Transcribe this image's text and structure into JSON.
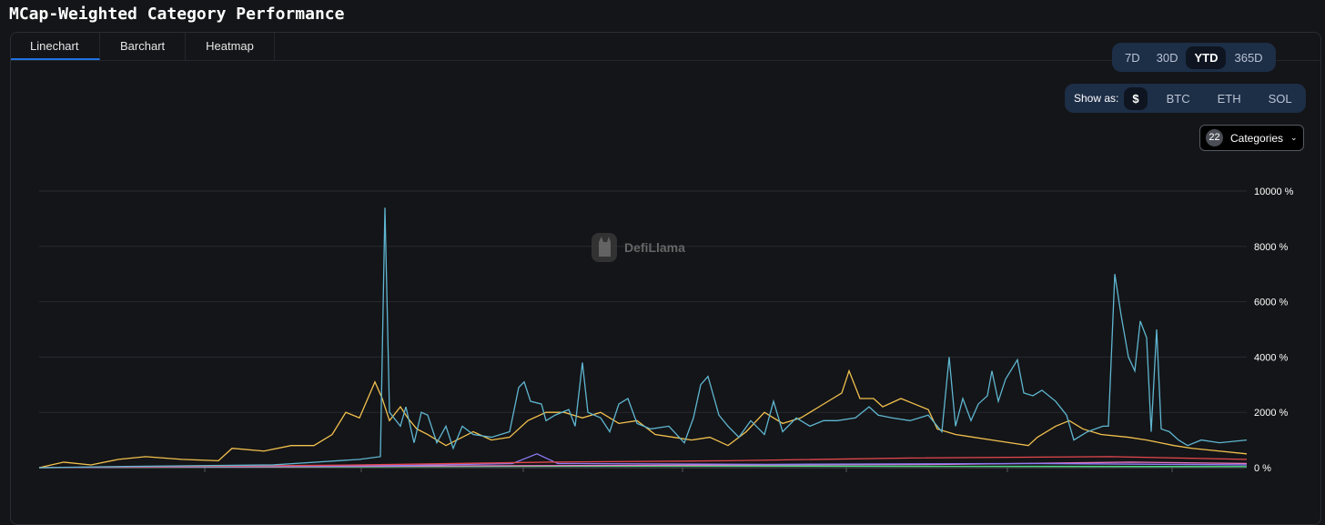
{
  "title": "MCap-Weighted Category Performance",
  "tabs": [
    "Linechart",
    "Barchart",
    "Heatmap"
  ],
  "ranges": [
    "7D",
    "30D",
    "YTD",
    "365D"
  ],
  "selected_range": "YTD",
  "show_as": {
    "label": "Show as:",
    "options": [
      "$",
      "BTC",
      "ETH",
      "SOL"
    ],
    "selected": "$"
  },
  "categories": {
    "count": "22",
    "label": "Categories"
  },
  "watermark": "DefiLlama",
  "colors": {
    "accent": "#2172e5"
  },
  "chart_data": {
    "type": "line",
    "title": "",
    "xlabel": "",
    "ylabel": "",
    "ylim": [
      0,
      10000
    ],
    "xlim": [
      0,
      132.7
    ],
    "grid": true,
    "yticks": [
      "0 %",
      "2000 %",
      "4000 %",
      "6000 %",
      "8000 %",
      "10000 %"
    ],
    "series": [
      {
        "name": "series-blue",
        "color": "#5fb6d1",
        "points": [
          [
            0,
            0
          ],
          [
            10.7,
            50
          ],
          [
            25.7,
            100
          ],
          [
            35.2,
            300
          ],
          [
            37.5,
            400
          ],
          [
            38,
            9400
          ],
          [
            38.5,
            2000
          ],
          [
            39.7,
            1500
          ],
          [
            40.3,
            2200
          ],
          [
            41.2,
            900
          ],
          [
            42,
            2000
          ],
          [
            42.7,
            1900
          ],
          [
            43.7,
            900
          ],
          [
            44.7,
            1500
          ],
          [
            45.5,
            700
          ],
          [
            46.5,
            1500
          ],
          [
            47.7,
            1200
          ],
          [
            49.7,
            1100
          ],
          [
            51.7,
            1300
          ],
          [
            52.7,
            2900
          ],
          [
            53.3,
            3100
          ],
          [
            54,
            2400
          ],
          [
            55.2,
            2300
          ],
          [
            55.7,
            1700
          ],
          [
            56.7,
            1900
          ],
          [
            58.2,
            2100
          ],
          [
            58.9,
            1500
          ],
          [
            59.7,
            3800
          ],
          [
            60.3,
            2000
          ],
          [
            61.7,
            1800
          ],
          [
            62.7,
            1300
          ],
          [
            63.7,
            2300
          ],
          [
            64.7,
            2500
          ],
          [
            65.7,
            1600
          ],
          [
            67.2,
            1400
          ],
          [
            69.2,
            1500
          ],
          [
            70.9,
            900
          ],
          [
            71.9,
            1800
          ],
          [
            72.7,
            3000
          ],
          [
            73.5,
            3300
          ],
          [
            74.7,
            1900
          ],
          [
            75.7,
            1500
          ],
          [
            76.9,
            1100
          ],
          [
            78.2,
            1700
          ],
          [
            79.7,
            1200
          ],
          [
            80.7,
            2400
          ],
          [
            81.7,
            1300
          ],
          [
            83.2,
            1800
          ],
          [
            84.7,
            1500
          ],
          [
            86.2,
            1700
          ],
          [
            87.7,
            1700
          ],
          [
            89.7,
            1800
          ],
          [
            91.2,
            2200
          ],
          [
            92.2,
            1900
          ],
          [
            93.7,
            1800
          ],
          [
            95.7,
            1700
          ],
          [
            97.7,
            1900
          ],
          [
            99.2,
            1300
          ],
          [
            100,
            4000
          ],
          [
            100.7,
            1500
          ],
          [
            101.5,
            2500
          ],
          [
            102.4,
            1700
          ],
          [
            103.2,
            2300
          ],
          [
            104.2,
            2600
          ],
          [
            104.7,
            3500
          ],
          [
            105.4,
            2400
          ],
          [
            106.2,
            3200
          ],
          [
            107.5,
            3900
          ],
          [
            108.2,
            2700
          ],
          [
            109.2,
            2600
          ],
          [
            110.2,
            2800
          ],
          [
            111.7,
            2400
          ],
          [
            112.9,
            1900
          ],
          [
            113.7,
            1000
          ],
          [
            115.2,
            1300
          ],
          [
            116.9,
            1500
          ],
          [
            117.5,
            1500
          ],
          [
            118.2,
            7000
          ],
          [
            118.9,
            5500
          ],
          [
            119.7,
            4000
          ],
          [
            120.4,
            3500
          ],
          [
            121,
            5300
          ],
          [
            121.7,
            4700
          ],
          [
            122.2,
            1300
          ],
          [
            122.8,
            5000
          ],
          [
            123.3,
            1400
          ],
          [
            124.2,
            1300
          ],
          [
            125.2,
            1000
          ],
          [
            126.2,
            800
          ],
          [
            127.7,
            1000
          ],
          [
            129.7,
            900
          ],
          [
            132.7,
            1000
          ]
        ]
      },
      {
        "name": "series-yellow",
        "color": "#f2c14e",
        "points": [
          [
            0,
            0
          ],
          [
            2.7,
            200
          ],
          [
            5.7,
            100
          ],
          [
            8.7,
            300
          ],
          [
            11.7,
            400
          ],
          [
            15.7,
            300
          ],
          [
            19.7,
            250
          ],
          [
            21.2,
            700
          ],
          [
            24.7,
            600
          ],
          [
            27.7,
            800
          ],
          [
            30.2,
            800
          ],
          [
            32.2,
            1200
          ],
          [
            33.7,
            2000
          ],
          [
            35.2,
            1800
          ],
          [
            36.9,
            3100
          ],
          [
            37.7,
            2500
          ],
          [
            38.5,
            1700
          ],
          [
            39.7,
            2200
          ],
          [
            40.5,
            1800
          ],
          [
            41.5,
            1400
          ],
          [
            42.7,
            1200
          ],
          [
            44.7,
            800
          ],
          [
            46.5,
            1100
          ],
          [
            47.7,
            1300
          ],
          [
            49.7,
            1000
          ],
          [
            51.7,
            1100
          ],
          [
            53.7,
            1700
          ],
          [
            55.7,
            2000
          ],
          [
            57.7,
            2000
          ],
          [
            59.7,
            1800
          ],
          [
            61.7,
            2000
          ],
          [
            63.7,
            1600
          ],
          [
            65.7,
            1700
          ],
          [
            67.7,
            1200
          ],
          [
            69.7,
            1100
          ],
          [
            71.7,
            1000
          ],
          [
            73.7,
            1100
          ],
          [
            75.7,
            800
          ],
          [
            77.7,
            1300
          ],
          [
            79.7,
            2000
          ],
          [
            81.7,
            1600
          ],
          [
            83.7,
            1800
          ],
          [
            85.7,
            2200
          ],
          [
            87.2,
            2500
          ],
          [
            88.2,
            2700
          ],
          [
            89,
            3500
          ],
          [
            90.2,
            2500
          ],
          [
            91.7,
            2500
          ],
          [
            92.7,
            2200
          ],
          [
            94.7,
            2500
          ],
          [
            96.2,
            2300
          ],
          [
            97.7,
            2100
          ],
          [
            98.7,
            1400
          ],
          [
            100.7,
            1200
          ],
          [
            102.7,
            1100
          ],
          [
            104.7,
            1000
          ],
          [
            106.7,
            900
          ],
          [
            108.7,
            800
          ],
          [
            109.7,
            1100
          ],
          [
            111.7,
            1500
          ],
          [
            113.2,
            1700
          ],
          [
            114.7,
            1400
          ],
          [
            116.7,
            1200
          ],
          [
            119.7,
            1100
          ],
          [
            121.7,
            1000
          ],
          [
            124.7,
            800
          ],
          [
            126.7,
            700
          ],
          [
            129.7,
            600
          ],
          [
            132.7,
            500
          ]
        ]
      },
      {
        "name": "series-red",
        "color": "#e5484d",
        "points": [
          [
            0,
            0
          ],
          [
            35.7,
            100
          ],
          [
            55.7,
            200
          ],
          [
            75.7,
            250
          ],
          [
            95.7,
            350
          ],
          [
            117.7,
            400
          ],
          [
            132.7,
            300
          ]
        ]
      },
      {
        "name": "series-purple",
        "color": "#8b7cf6",
        "points": [
          [
            0,
            0
          ],
          [
            40,
            80
          ],
          [
            52,
            150
          ],
          [
            54.7,
            500
          ],
          [
            57,
            150
          ],
          [
            80,
            120
          ],
          [
            110,
            150
          ],
          [
            132.7,
            100
          ]
        ]
      },
      {
        "name": "series-pink",
        "color": "#e879c0",
        "points": [
          [
            0,
            0
          ],
          [
            40,
            60
          ],
          [
            70,
            90
          ],
          [
            100,
            120
          ],
          [
            120,
            200
          ],
          [
            132.7,
            150
          ]
        ]
      },
      {
        "name": "series-green",
        "color": "#4ade80",
        "points": [
          [
            0,
            0
          ],
          [
            40,
            40
          ],
          [
            70,
            60
          ],
          [
            100,
            50
          ],
          [
            132.7,
            40
          ]
        ]
      }
    ]
  }
}
